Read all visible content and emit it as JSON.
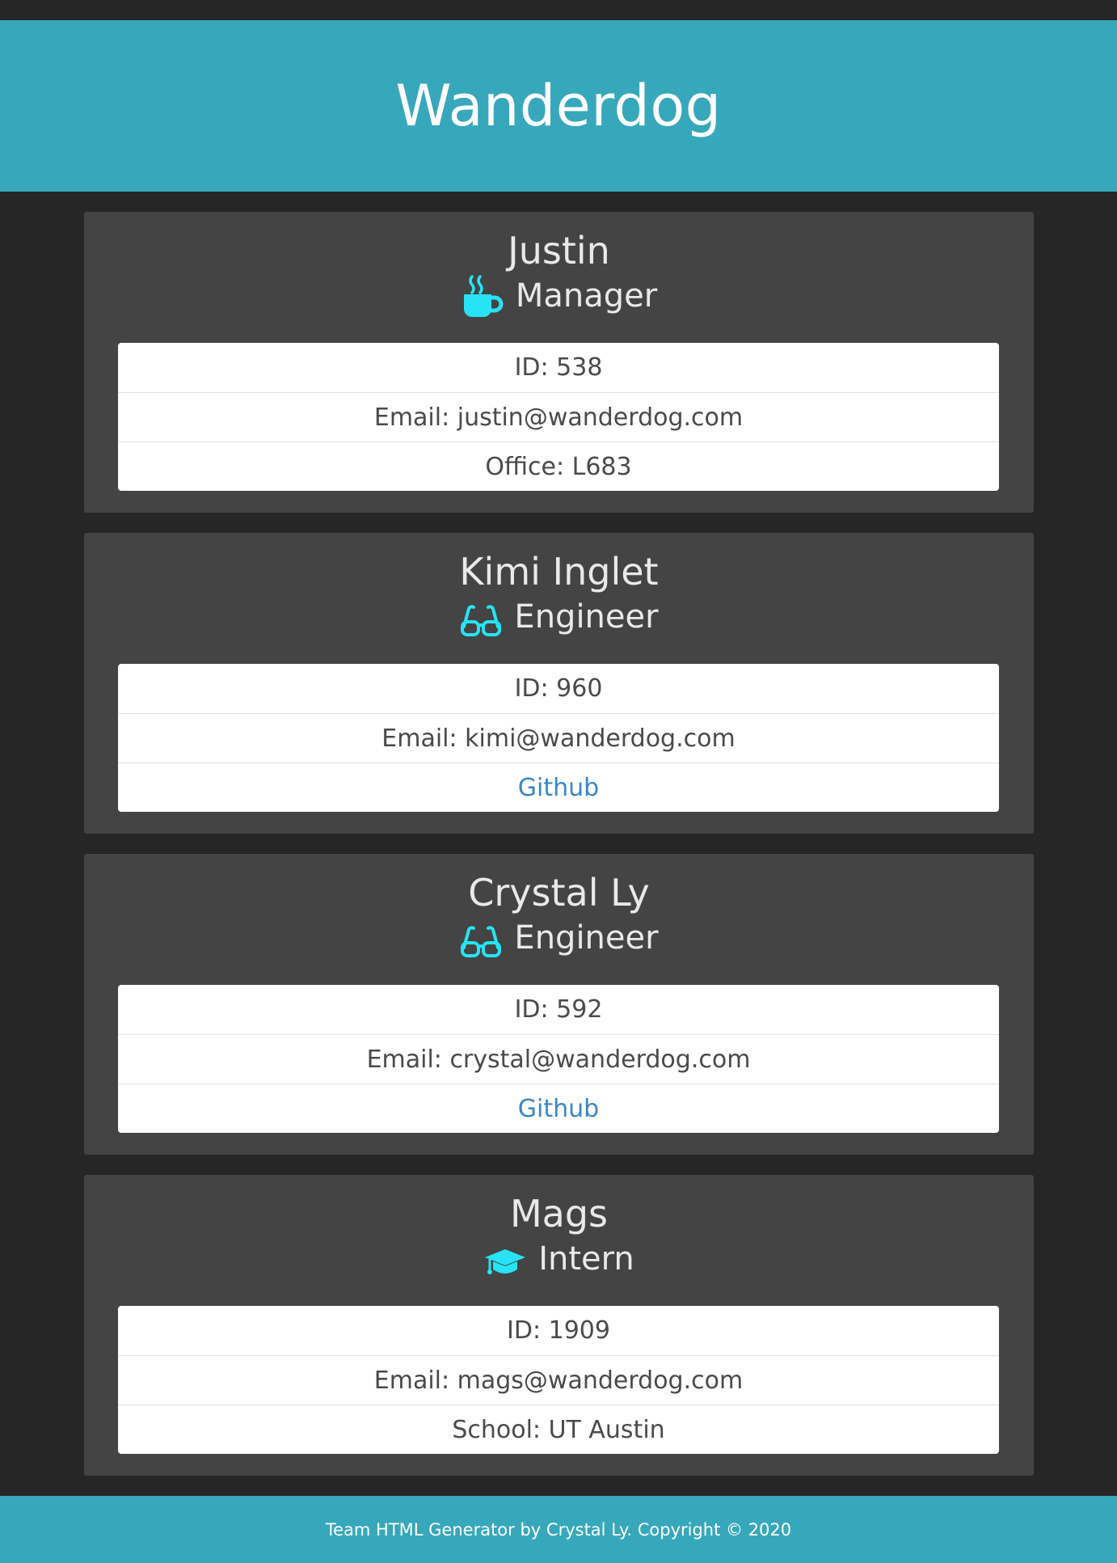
{
  "header": {
    "title": "Wanderdog"
  },
  "colors": {
    "accent": "#37a8bb",
    "card_bg": "#434443",
    "page_bg": "#262626",
    "icon": "#27e3f5",
    "link": "#3a86c8"
  },
  "team": [
    {
      "name": "Justin",
      "role": "Manager",
      "icon": "coffee-mug-icon",
      "id_text": "ID: 538",
      "email_text": "Email: justin@wanderdog.com",
      "extra_text": "Office: L683",
      "extra_is_link": false
    },
    {
      "name": "Kimi Inglet",
      "role": "Engineer",
      "icon": "glasses-icon",
      "id_text": "ID: 960",
      "email_text": "Email: kimi@wanderdog.com",
      "extra_text": "Github",
      "extra_is_link": true
    },
    {
      "name": "Crystal Ly",
      "role": "Engineer",
      "icon": "glasses-icon",
      "id_text": "ID: 592",
      "email_text": "Email: crystal@wanderdog.com",
      "extra_text": "Github",
      "extra_is_link": true
    },
    {
      "name": "Mags",
      "role": "Intern",
      "icon": "graduation-cap-icon",
      "id_text": "ID: 1909",
      "email_text": "Email: mags@wanderdog.com",
      "extra_text": "School: UT Austin",
      "extra_is_link": false
    }
  ],
  "footer": {
    "text": "Team HTML Generator by Crystal Ly. Copyright © 2020"
  }
}
